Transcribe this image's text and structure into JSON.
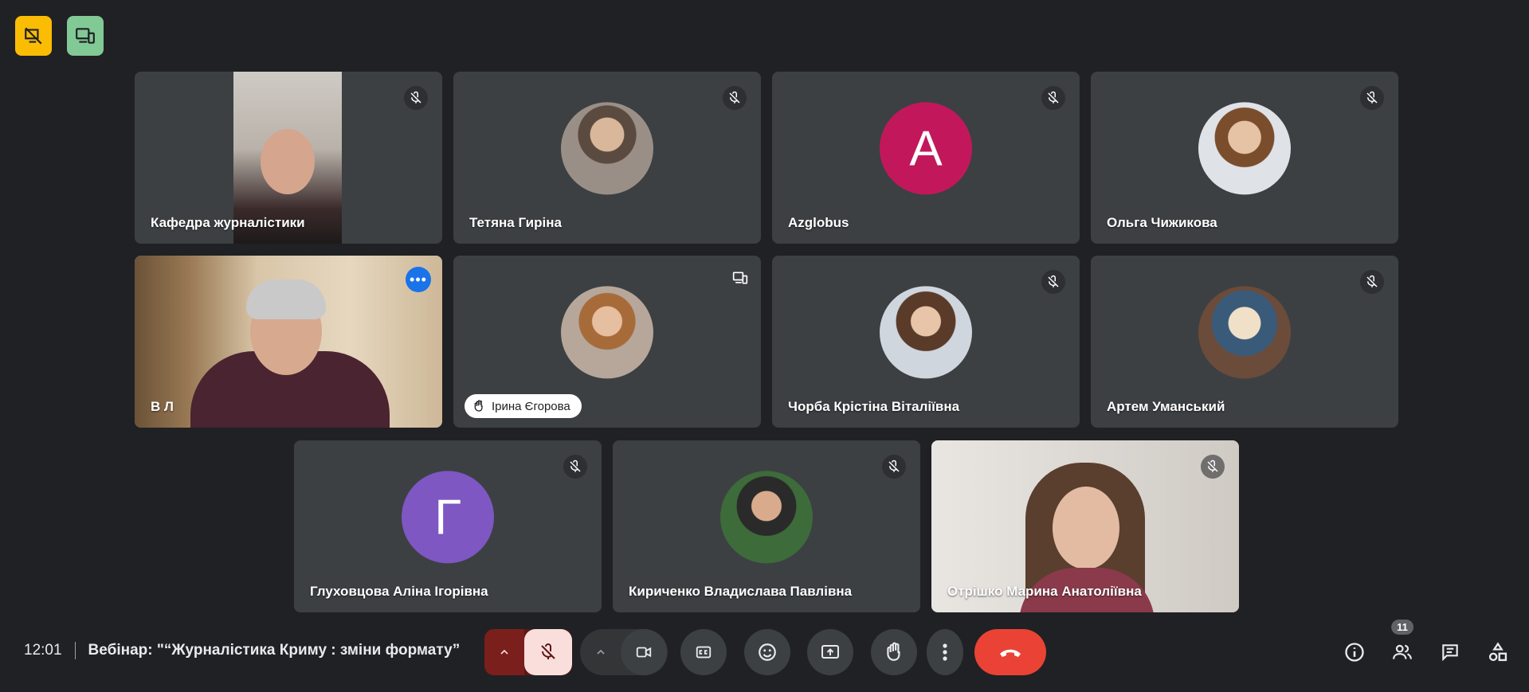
{
  "top_badges": [
    {
      "icon": "no-video-presentation-icon",
      "color": "#fbbc04"
    },
    {
      "icon": "companion-mode-icon",
      "color": "#81c995"
    }
  ],
  "participants": [
    {
      "name": "Кафедра журналістики",
      "muted": true,
      "view": "video"
    },
    {
      "name": "Тетяна Гиріна",
      "muted": true,
      "view": "photo-avatar"
    },
    {
      "name": "Azglobus",
      "muted": true,
      "view": "letter-avatar",
      "initial": "A",
      "avatar_color": "#c2185b"
    },
    {
      "name": "Ольга Чижикова",
      "muted": true,
      "view": "photo-avatar"
    },
    {
      "name": "В Л",
      "muted": false,
      "view": "video",
      "active": true
    },
    {
      "name": "Ірина Єгорова",
      "muted": false,
      "view": "photo-avatar",
      "hand_raised": true,
      "companion": true
    },
    {
      "name": "Чорба Крістіна Віталіївна",
      "muted": true,
      "view": "photo-avatar"
    },
    {
      "name": "Артем Уманський",
      "muted": true,
      "view": "photo-avatar"
    },
    {
      "name": "Глуховцова Аліна Ігорівна",
      "muted": true,
      "view": "letter-avatar",
      "initial": "Г",
      "avatar_color": "#7e57c2"
    },
    {
      "name": "Кириченко Владислава Павлівна",
      "muted": true,
      "view": "photo-avatar"
    },
    {
      "name": "Отрішко Марина Анатоліївна",
      "muted": true,
      "view": "video"
    }
  ],
  "meeting": {
    "time": "12:01",
    "title": "Вебінар: \"“Журналістика Криму : зміни формату”"
  },
  "controls": {
    "mic_state": "off",
    "people_count": "11"
  },
  "colors": {
    "background": "#202124",
    "tile": "#3c4043",
    "end_call": "#ea4335",
    "mic_off_bg": "#f9dedc",
    "active_outline": "#8ab4f8"
  }
}
